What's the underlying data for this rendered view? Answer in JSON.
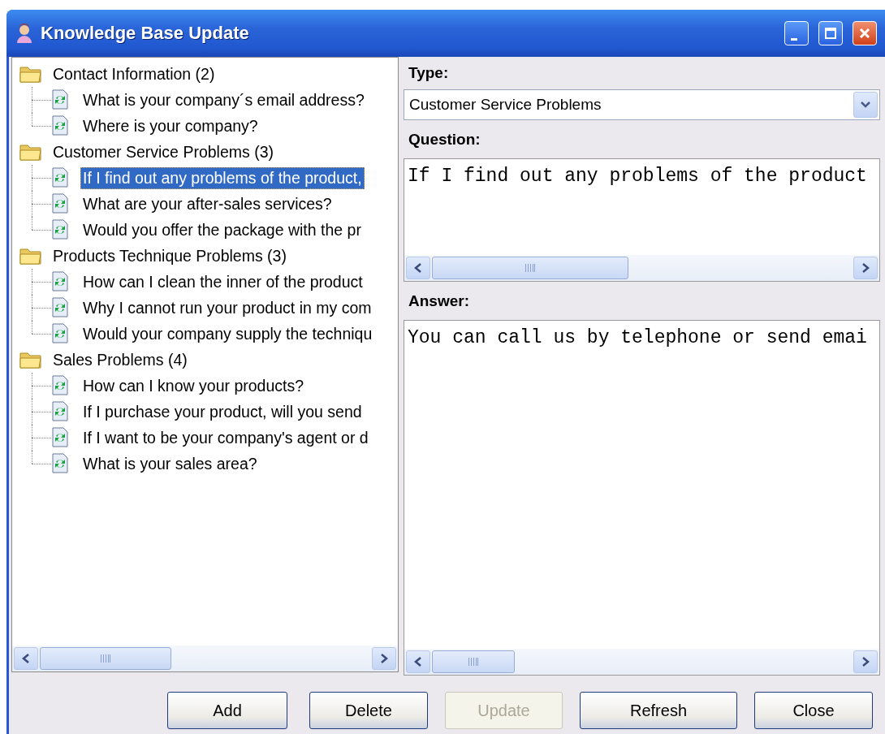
{
  "window": {
    "title": "Knowledge Base Update"
  },
  "tree": [
    {
      "label": "Contact Information (2)",
      "children": [
        {
          "label": "What is your company´s email address?",
          "selected": false
        },
        {
          "label": "Where is your company?",
          "selected": false
        }
      ]
    },
    {
      "label": "Customer Service Problems (3)",
      "children": [
        {
          "label": "If I find out any problems of the product,",
          "selected": true
        },
        {
          "label": "What are your after-sales services?",
          "selected": false
        },
        {
          "label": "Would you offer the package with the pr",
          "selected": false
        }
      ]
    },
    {
      "label": "Products Technique Problems (3)",
      "children": [
        {
          "label": "How can I clean the inner of the product",
          "selected": false
        },
        {
          "label": "Why I cannot run your product in my com",
          "selected": false
        },
        {
          "label": "Would your company supply the techniqu",
          "selected": false
        }
      ]
    },
    {
      "label": "Sales Problems (4)",
      "children": [
        {
          "label": "How can I know your products?",
          "selected": false
        },
        {
          "label": "If I purchase your product, will you send",
          "selected": false
        },
        {
          "label": "If I want to be your company's agent or d",
          "selected": false
        },
        {
          "label": "What is your sales area?",
          "selected": false
        }
      ]
    }
  ],
  "form": {
    "type_label": "Type:",
    "type_value": "Customer Service Problems",
    "question_label": "Question:",
    "question_value": "If I find out any problems of the product",
    "answer_label": "Answer:",
    "answer_value": "You can call us by telephone or send emai"
  },
  "buttons": [
    {
      "label": "Add",
      "disabled": false
    },
    {
      "label": "Delete",
      "disabled": false
    },
    {
      "label": "Update",
      "disabled": true
    },
    {
      "label": "Refresh",
      "disabled": false
    },
    {
      "label": "Close",
      "disabled": false
    }
  ]
}
